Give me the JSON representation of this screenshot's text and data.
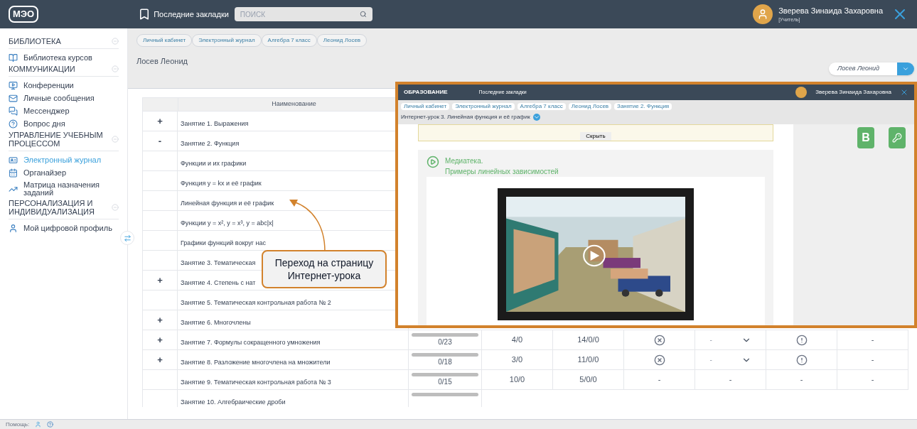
{
  "top_bar": {
    "logo": "МЭО",
    "bookmarks": "Последние закладки",
    "search_placeholder": "ПОИСК",
    "user_name": "Зверева Зинаида Захаровна",
    "user_role": "[Учитель]"
  },
  "sidebar": {
    "sections": [
      {
        "title": "БИБЛИОТЕКА",
        "items": [
          {
            "label": "Библиотека курсов",
            "selected": false
          }
        ]
      },
      {
        "title": "КОММУНИКАЦИИ",
        "items": [
          {
            "label": "Конференции",
            "selected": false
          },
          {
            "label": "Личные сообщения",
            "selected": false
          },
          {
            "label": "Мессенджер",
            "selected": false
          },
          {
            "label": "Вопрос дня",
            "selected": false
          }
        ]
      },
      {
        "title": "УПРАВЛЕНИЕ УЧЕБНЫМ ПРОЦЕССОМ",
        "items": [
          {
            "label": "Электронный журнал",
            "selected": true
          },
          {
            "label": "Органайзер",
            "selected": false
          },
          {
            "label": "Матрица назначения заданий",
            "selected": false
          }
        ]
      },
      {
        "title": "ПЕРСОНАЛИЗАЦИЯ И ИНДИВИДУАЛИЗАЦИЯ",
        "items": [
          {
            "label": "Мой цифровой профиль",
            "selected": false
          }
        ]
      }
    ]
  },
  "breadcrumbs": [
    "Личный кабинет",
    "Электронный журнал",
    "Алгебра 7 класс",
    "Леонид Лосев"
  ],
  "page_title": "Лосев Леонид",
  "student_select": {
    "value": "Лосев Леонид"
  },
  "table": {
    "columns": [
      "Наименование"
    ],
    "rows": [
      {
        "toggle": "+",
        "name": "Занятие 1. Выражения"
      },
      {
        "toggle": "-",
        "name": "Занятие 2. Функция"
      },
      {
        "name": "Функции и их графики"
      },
      {
        "name": "Функция y = kx и её график"
      },
      {
        "name": "Линейная функция и её график"
      },
      {
        "name": "Функции y = x², y = x³, y = abc|x|"
      },
      {
        "name": "Графики функций вокруг нас"
      },
      {
        "name": "Занятие 3. Тематическая"
      },
      {
        "toggle": "+",
        "name": "Занятие 4. Степень с нат"
      },
      {
        "name": "Занятие 5. Тематическая контрольная работа № 2"
      },
      {
        "toggle": "+",
        "name": "Занятие 6. Многочлены"
      },
      {
        "toggle": "+",
        "name": "Занятие 7. Формулы сокращенного умножения",
        "progress": {
          "label": "0/23",
          "level": 0
        },
        "cells": [
          {
            "kind": "text",
            "text": "4/0"
          },
          {
            "kind": "text",
            "text": "14/0/0"
          },
          {
            "kind": "cancel"
          },
          {
            "kind": "dropdown",
            "text": "-"
          },
          {
            "kind": "alert"
          },
          {
            "kind": "text",
            "text": "-"
          }
        ]
      },
      {
        "toggle": "+",
        "name": "Занятие 8. Разложение многочлена на множители",
        "progress": {
          "label": "0/18",
          "level": 0
        },
        "cells": [
          {
            "kind": "text",
            "text": "3/0"
          },
          {
            "kind": "text",
            "text": "11/0/0"
          },
          {
            "kind": "cancel"
          },
          {
            "kind": "dropdown",
            "text": "-"
          },
          {
            "kind": "alert"
          },
          {
            "kind": "text",
            "text": "-"
          }
        ]
      },
      {
        "name": "Занятие 9. Тематическая контрольная работа № 3",
        "progress": {
          "label": "0/15",
          "level": 0
        },
        "cells": [
          {
            "kind": "text",
            "text": "10/0"
          },
          {
            "kind": "text",
            "text": "5/0/0"
          },
          {
            "kind": "text",
            "text": "-"
          },
          {
            "kind": "text",
            "text": "-"
          },
          {
            "kind": "text",
            "text": "-"
          },
          {
            "kind": "text",
            "text": "-"
          }
        ]
      },
      {
        "name": "Занятие 10. Алгебраические дроби",
        "progress": {
          "level": 0
        }
      }
    ]
  },
  "inset": {
    "brand": "ОБРАЗОВАНИЕ",
    "bookmarks": "Последние закладки",
    "user_name": "Зверева Зинаида Захаровна",
    "breadcrumbs": [
      "Личный кабинет",
      "Электронный журнал",
      "Алгебра 7 класс",
      "Леонид Лосев",
      "Занятие 2. Функция"
    ],
    "lesson": "Интернет-урок 3. Линейная функция и её график",
    "hide_button": "Скрыть",
    "media_title": "Медиатека.",
    "media_subtitle": "Примеры линейных зависимостей",
    "side_buttons": [
      {
        "kind": "letter",
        "text": "В"
      },
      {
        "kind": "key"
      }
    ]
  },
  "callout": {
    "lines": [
      "Переход на страницу",
      "Интернет-урока"
    ]
  },
  "status_bar": {
    "help": "Помощь:"
  }
}
